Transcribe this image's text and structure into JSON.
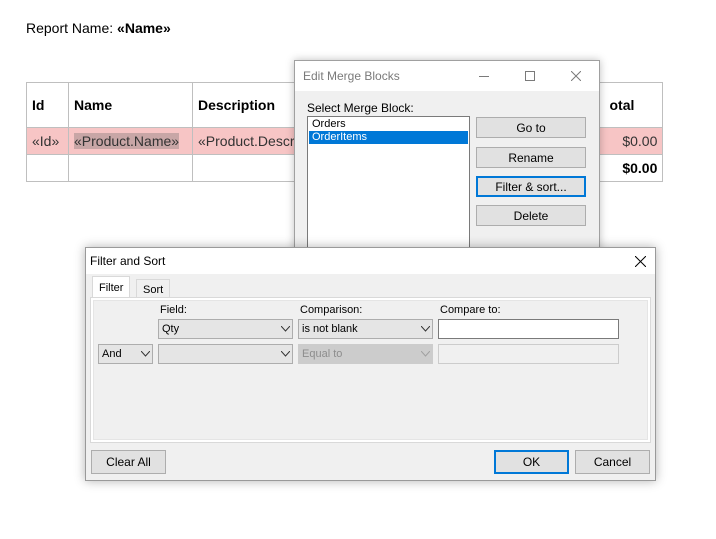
{
  "document": {
    "report_label": "Report Name:",
    "report_field": "«Name»",
    "table": {
      "headers": [
        "Id",
        "Name",
        "Description",
        "otal"
      ],
      "row_fields": [
        "«Id»",
        "«Product.Name»",
        "«Product.Descrip",
        "$0.00"
      ],
      "total_value": "$0.00"
    }
  },
  "edit_merge_blocks": {
    "title": "Edit Merge Blocks",
    "list_label": "Select Merge Block:",
    "items": [
      "Orders",
      "OrderItems"
    ],
    "selected_item": "OrderItems",
    "buttons": {
      "goto": "Go to",
      "rename": "Rename",
      "filter_sort": "Filter & sort...",
      "delete": "Delete"
    }
  },
  "filter_sort": {
    "title": "Filter and Sort",
    "tabs": [
      "Filter",
      "Sort"
    ],
    "active_tab": "Filter",
    "columns": {
      "field": "Field:",
      "comparison": "Comparison:",
      "compare_to": "Compare to:"
    },
    "row1": {
      "field": "Qty",
      "comparison": "is not blank",
      "compare_to": ""
    },
    "row2": {
      "logic": "And",
      "field": "",
      "comparison": "Equal to",
      "compare_to": ""
    },
    "buttons": {
      "clear_all": "Clear All",
      "ok": "OK",
      "cancel": "Cancel"
    }
  },
  "icons": {
    "minimize": "minimize-icon",
    "maximize": "maximize-icon",
    "close": "close-icon",
    "dropdown": "chevron-down-icon"
  },
  "colors": {
    "selection": "#0078d7",
    "merge_row_highlight": "#f7c5c5"
  }
}
